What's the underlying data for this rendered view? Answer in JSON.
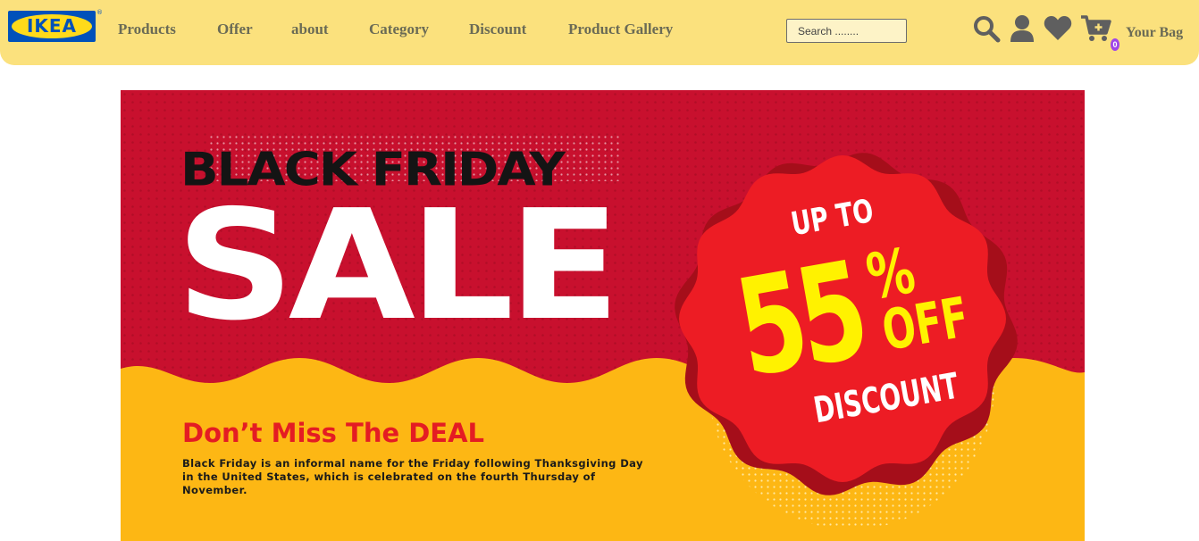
{
  "brand": {
    "logo_text": "IKEA",
    "registered_mark": "®"
  },
  "nav": {
    "links": [
      "Products",
      "Offer",
      "about",
      "Category",
      "Discount",
      "Product Gallery"
    ]
  },
  "search": {
    "placeholder": "Search ........"
  },
  "header_icons": [
    "search-icon",
    "user-icon",
    "heart-icon",
    "cart-icon"
  ],
  "bag": {
    "count": "0",
    "label": "Your Bag"
  },
  "banner": {
    "headline": "BLACK FRIDAY",
    "sale": "SALE",
    "badge_top": "UP TO",
    "badge_number": "55",
    "badge_percent": "%",
    "badge_off": "OFF",
    "badge_bottom": "DISCOUNT",
    "deal_prefix": "Don’t Miss The ",
    "deal_emphasis": "DEAL",
    "description": "Black Friday is an informal name for the Friday following Thanksgiving Day in the United States, which is celebrated on the fourth Thursday of November."
  },
  "colors": {
    "navbar": "#fbe17d",
    "nav_text": "#6b6b55",
    "banner_red": "#c8102e",
    "banner_yellow": "#fdb714",
    "badge_red": "#ed1c24",
    "badge_yellow_text": "#fff200",
    "bag_badge": "#a046e8"
  }
}
